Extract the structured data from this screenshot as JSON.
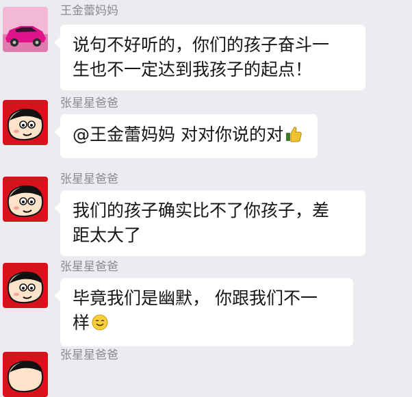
{
  "messages": [
    {
      "sender": "王金蕾妈妈",
      "avatar": "car-avatar",
      "lines": [
        "说句不好听的，你们的孩子奋斗一",
        "生也不一定达到我孩子的起点！"
      ]
    },
    {
      "sender": "张星星爸爸",
      "avatar": "cartoon-boy-avatar",
      "lines": [
        "@王金蕾妈妈 对对你说的对"
      ],
      "emoji": "thumbs-up-emoji"
    },
    {
      "sender": "张星星爸爸",
      "avatar": "cartoon-boy-avatar",
      "lines": [
        "我们的孩子确实比不了你孩子，差",
        "距太大了"
      ]
    },
    {
      "sender": "张星星爸爸",
      "avatar": "cartoon-boy-avatar",
      "lines": [
        "毕竟我们是幽默，  你跟我们不一",
        "样"
      ],
      "emoji": "smile-emoji"
    },
    {
      "sender": "张星星爸爸",
      "avatar": "cartoon-boy-avatar"
    }
  ]
}
